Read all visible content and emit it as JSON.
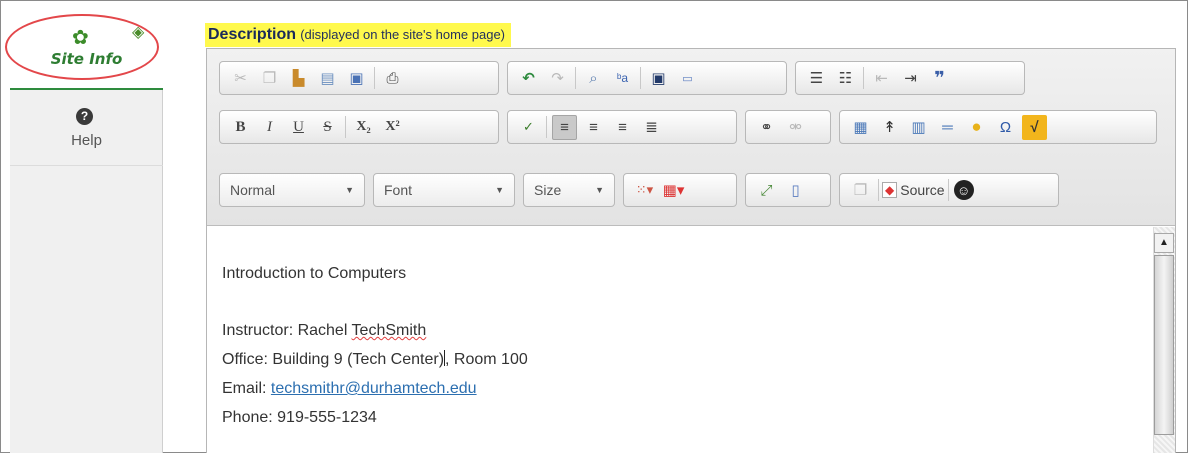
{
  "sidebar": {
    "site_info_label": "Site Info",
    "help_label": "Help",
    "help_icon_glyph": "?"
  },
  "description": {
    "title": "Description",
    "subtitle": "(displayed on the site's home page)"
  },
  "toolbar": {
    "format_combo": "Normal",
    "font_combo": "Font",
    "size_combo": "Size",
    "source_label": "Source",
    "bold": "B",
    "italic": "I",
    "underline": "U",
    "strike": "S",
    "subscript": "X₂",
    "superscript": "X²"
  },
  "content": {
    "line1": "Introduction to Computers",
    "instructor_prefix": "Instructor: Rachel ",
    "instructor_name_misspelled": "TechSmith",
    "office_before_caret": "Office: Building 9 (Tech Center)",
    "office_after_caret": ", Room 100",
    "email_prefix": "Email: ",
    "email_link": "techsmithr@durhamtech.edu",
    "phone": "Phone: 919-555-1234"
  },
  "colors": {
    "highlight": "#fff94d",
    "active_tab_underline": "#2e8b3e",
    "annotation_ellipse": "#e3474a",
    "link": "#2c6fb0"
  }
}
